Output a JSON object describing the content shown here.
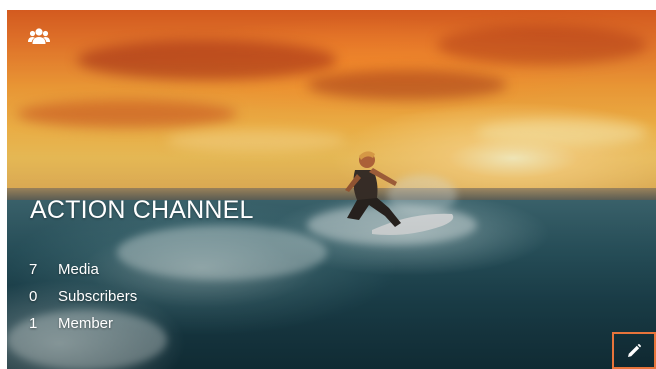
{
  "channel": {
    "title": "ACTION CHANNEL",
    "icon": "group-icon",
    "stats": [
      {
        "count": "7",
        "label": "Media"
      },
      {
        "count": "0",
        "label": "Subscribers"
      },
      {
        "count": "1",
        "label": "Member"
      }
    ],
    "edit_icon": "pencil-icon",
    "colors": {
      "text": "#ffffff",
      "edit_border": "#e8743b"
    }
  }
}
